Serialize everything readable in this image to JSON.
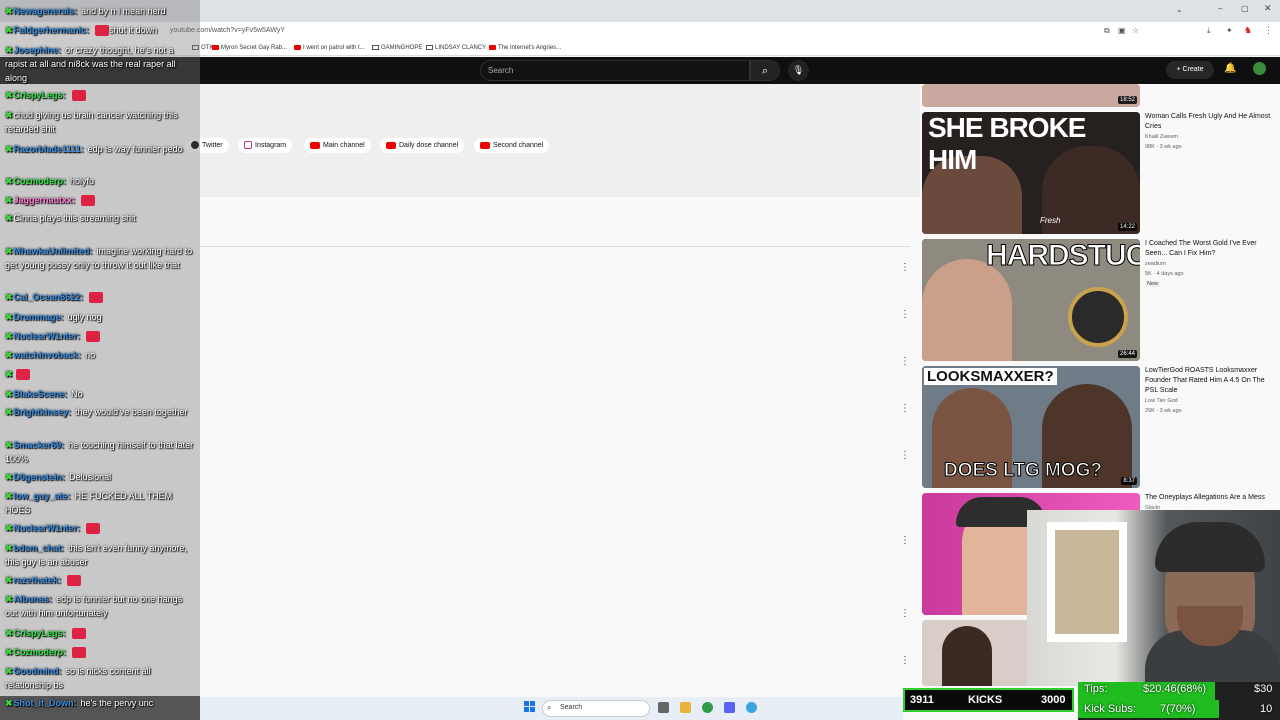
{
  "browser": {
    "url": "youtube.com/watch?v=yFv5w5AWyY",
    "bookmarks": [
      "OTK",
      "Myron Secret Gay Rab...",
      "I went on patrol with t...",
      "GAMINGHOPE",
      "LINDSAY CLANCY",
      "The Internet's Angries..."
    ]
  },
  "youtube": {
    "search_placeholder": "Search",
    "search_icon": "search-icon",
    "mic_icon": "mic-icon",
    "create_label": "Create",
    "bell_icon": "bell-icon",
    "links": [
      "Twitter",
      "Instagram",
      "Main channel",
      "Daily dose channel",
      "Second channel"
    ]
  },
  "recommendations": [
    {
      "title": "",
      "channel": "",
      "meta": "",
      "duration": "18:52",
      "thumb_bg": "#c9a8a0"
    },
    {
      "title": "Woman Calls Fresh Ugly And He Almost Cries",
      "channel": "Khalil Zweem",
      "meta": "98K · 3 wk ago",
      "duration": "14:22",
      "thumb_text": "SHE BROKE HIM",
      "thumb_bg": "#2b2326",
      "overlay": "Fresh"
    },
    {
      "title": "I Coached The Worst Gold I've Ever Seen... Can I Fix Him?",
      "channel": "zeadium",
      "meta": "5K · 4 days ago",
      "badge": "New",
      "duration": "26:44",
      "thumb_text": "HARDSTUCK",
      "thumb_bg": "#3a3530"
    },
    {
      "title": "LowTierGod ROASTS Looksmaxxer Founder That Rated Him A 4.5 On The PSL Scale",
      "channel": "Low Tier God",
      "meta": "29K · 3 wk ago",
      "duration": "8:37",
      "thumb_text": "LOOKSMAXXER?",
      "thumb_text2": "DOES LTG MOG?",
      "thumb_bg": "#5b6a79"
    },
    {
      "title": "The Oneyplays Allegations Are a Mess",
      "channel": "Slackr",
      "meta": "",
      "duration": "",
      "thumb_bg": "#d14fae"
    },
    {
      "title": "",
      "channel": "",
      "meta": "",
      "duration": "",
      "thumb_bg": "#d9cfc8"
    }
  ],
  "chat": [
    {
      "user": "Newagenerals",
      "text": "and by n i mean nerd",
      "color": "blue"
    },
    {
      "user": "Faldgerhermanic",
      "text": "shut it down",
      "color": "blue",
      "emote": true
    },
    {
      "user": "Josephine",
      "text": "or crazy thought, he's not a rapist at all and ni8ck was the real raper all along",
      "color": "blue"
    },
    {
      "user": "CrispyLegs",
      "text": "",
      "color": "green",
      "emote": true
    },
    {
      "user": "",
      "text": "chud giving us brain cancer watching this retarded shit",
      "color": "blue"
    },
    {
      "user": "Razorblade1111",
      "text": "edp is way funnier pedo",
      "color": "blue"
    },
    {
      "user": "Cozmoderp",
      "text": "holyfu",
      "color": "green"
    },
    {
      "user": "Jaggernautxx",
      "text": "",
      "color": "pink",
      "emote": true
    },
    {
      "user": "",
      "text": "Cinna plays this streaming shit",
      "color": "blue"
    },
    {
      "user": "MhawkaUnlimited",
      "text": "imagine working hard to get young pussy only to throw it out like that",
      "color": "blue"
    },
    {
      "user": "Cal_Ocean8622",
      "text": "",
      "color": "blue",
      "emote": true
    },
    {
      "user": "Drummage",
      "text": "ugly nog",
      "color": "blue"
    },
    {
      "user": "NuclearW1nter",
      "text": "",
      "color": "blue",
      "emote": true
    },
    {
      "user": "watchinvoback",
      "text": "no",
      "color": "blue"
    },
    {
      "user": "",
      "text": "",
      "color": "blue",
      "emote": true
    },
    {
      "user": "BlakeScene",
      "text": "No",
      "color": "blue"
    },
    {
      "user": "Brightkinsey",
      "text": "they would've been together",
      "color": "blue"
    },
    {
      "user": "Smacker69",
      "text": "he touching himself to that later 100%",
      "color": "blue"
    },
    {
      "user": "D0genstein",
      "text": "Delusional",
      "color": "blue"
    },
    {
      "user": "low_guy_ate",
      "text": "HE FUCKED ALL THEM HOES",
      "color": "blue"
    },
    {
      "user": "NuclearW1nter",
      "text": "",
      "color": "blue",
      "emote": true
    },
    {
      "user": "bdsm_chat",
      "text": "this isn't even funny anymore, this guy is an abuser",
      "color": "blue"
    },
    {
      "user": "razethatek",
      "text": "",
      "color": "blue",
      "emote": true
    },
    {
      "user": "Albunas",
      "text": "edp is funnier but no one hangs out with him unfortunately",
      "color": "blue"
    },
    {
      "user": "CrispyLegs",
      "text": "",
      "color": "green",
      "emote": true
    },
    {
      "user": "Cozmoderp",
      "text": "",
      "color": "green",
      "emote": true
    },
    {
      "user": "Goodmind",
      "text": "so is nicks content all relationship bs",
      "color": "blue"
    },
    {
      "user": "Shot_it_Down",
      "text": "he's the pervy unc",
      "color": "blue"
    }
  ],
  "kicks": {
    "left": "3911",
    "label": "KICKS",
    "right": "3000"
  },
  "goals": {
    "tips_label": "Tips:",
    "tips_value": "$20.46(68%)",
    "tips_goal": "$30",
    "tips_pct": 0.68,
    "subs_label": "Kick Subs:",
    "subs_value": "7(70%)",
    "subs_goal": "10",
    "subs_pct": 0.7
  },
  "taskbar": {
    "search_label": "Search"
  }
}
